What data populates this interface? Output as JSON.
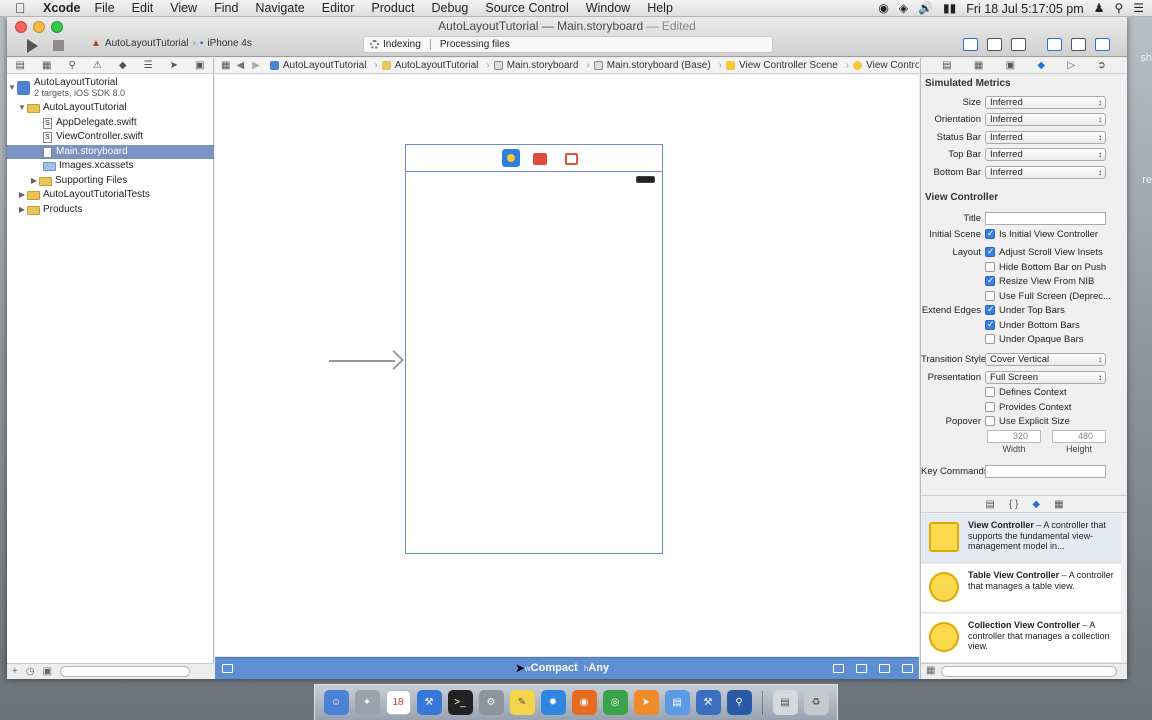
{
  "menubar": {
    "app_name": "Xcode",
    "items": [
      "File",
      "Edit",
      "View",
      "Find",
      "Navigate",
      "Editor",
      "Product",
      "Debug",
      "Source Control",
      "Window",
      "Help"
    ],
    "clock": "Fri 18 Jul  5:17:05 pm"
  },
  "window": {
    "title": "AutoLayoutTutorial",
    "title_sep": "—",
    "document": "Main.storyboard",
    "edited": "— Edited",
    "scheme": "AutoLayoutTutorial",
    "device": "iPhone 4s",
    "status_1": "Indexing",
    "status_2": "Processing files"
  },
  "navigator": {
    "project": "AutoLayoutTutorial",
    "project_sub": "2 targets, iOS SDK 8.0",
    "items": [
      {
        "label": "AutoLayoutTutorial",
        "kind": "folder"
      },
      {
        "label": "AppDelegate.swift",
        "kind": "swift"
      },
      {
        "label": "ViewController.swift",
        "kind": "swift"
      },
      {
        "label": "Main.storyboard",
        "kind": "storyboard"
      },
      {
        "label": "Images.xcassets",
        "kind": "assets"
      },
      {
        "label": "Supporting Files",
        "kind": "folder"
      },
      {
        "label": "AutoLayoutTutorialTests",
        "kind": "folder"
      },
      {
        "label": "Products",
        "kind": "folder"
      }
    ]
  },
  "jumpbar": [
    "AutoLayoutTutorial",
    "AutoLayoutTutorial",
    "Main.storyboard",
    "Main.storyboard (Base)",
    "View Controller Scene",
    "View Controller"
  ],
  "sizebar": {
    "w_prefix": "w",
    "w_value": "Compact",
    "h_prefix": "h",
    "h_value": "Any"
  },
  "inspector": {
    "simulated_metrics_title": "Simulated Metrics",
    "metrics": [
      {
        "label": "Size",
        "value": "Inferred"
      },
      {
        "label": "Orientation",
        "value": "Inferred"
      },
      {
        "label": "Status Bar",
        "value": "Inferred"
      },
      {
        "label": "Top Bar",
        "value": "Inferred"
      },
      {
        "label": "Bottom Bar",
        "value": "Inferred"
      }
    ],
    "vc_title": "View Controller",
    "title_label": "Title",
    "initial_scene_label": "Initial Scene",
    "is_initial": "Is Initial View Controller",
    "layout_label": "Layout",
    "layout_opts": [
      {
        "label": "Adjust Scroll View Insets",
        "checked": true
      },
      {
        "label": "Hide Bottom Bar on Push",
        "checked": false
      },
      {
        "label": "Resize View From NIB",
        "checked": true
      },
      {
        "label": "Use Full Screen (Deprec...",
        "checked": false
      }
    ],
    "extend_label": "Extend Edges",
    "extend_opts": [
      {
        "label": "Under Top Bars",
        "checked": true
      },
      {
        "label": "Under Bottom Bars",
        "checked": true
      },
      {
        "label": "Under Opaque Bars",
        "checked": false
      }
    ],
    "transition_label": "Transition Style",
    "transition_value": "Cover Vertical",
    "presentation_label": "Presentation",
    "presentation_value": "Full Screen",
    "defines_context": "Defines Context",
    "provides_context": "Provides Context",
    "popover_label": "Popover",
    "explicit_size": "Use Explicit Size",
    "width_value": "320",
    "height_value": "480",
    "width_label": "Width",
    "height_label": "Height",
    "key_commands_label": "Key Commands"
  },
  "library": [
    {
      "name": "View Controller",
      "desc": " – A controller that supports the fundamental view-management model in..."
    },
    {
      "name": "Table View Controller",
      "desc": " – A controller that manages a table view."
    },
    {
      "name": "Collection View Controller",
      "desc": " – A controller that manages a collection view."
    }
  ],
  "colors": {
    "accent": "#5e8fd2",
    "selection": "#7a93c0",
    "checkbox": "#3c7fe0"
  }
}
